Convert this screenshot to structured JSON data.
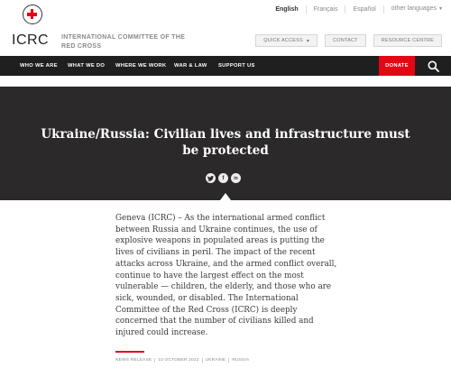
{
  "languages": [
    {
      "label": "English",
      "active": true
    },
    {
      "label": "Français",
      "active": false
    },
    {
      "label": "Español",
      "active": false
    },
    {
      "label": "other languages",
      "active": false
    }
  ],
  "logo": {
    "text": "ICRC"
  },
  "org_name": "INTERNATIONAL COMMITTEE OF THE RED CROSS",
  "utility": {
    "quick_access": "QUICK ACCESS",
    "contact": "CONTACT",
    "resource_centre": "RESOURCE CENTRE"
  },
  "nav": {
    "items": [
      "WHO WE ARE",
      "WHAT WE DO",
      "WHERE WE WORK",
      "WAR & LAW",
      "SUPPORT US"
    ],
    "donate": "DONATE"
  },
  "hero": {
    "title": "Ukraine/Russia: Civilian lives and infrastructure must be protected"
  },
  "share": [
    "twitter-icon",
    "facebook-icon",
    "linkedin-icon"
  ],
  "article": {
    "body": "Geneva (ICRC) – As the international armed conflict between Russia and Ukraine continues, the use of explosive weapons in populated areas is putting the lives of civilians in peril. The impact of the recent attacks across Ukraine, and the armed conflict overall, continue to have the largest effect on the most vulnerable — children, the elderly, and those who are sick, wounded, or disabled. The International Committee of the Red Cross (ICRC) is deeply concerned that the number of civilians killed and injured could increase."
  },
  "meta": {
    "type": "NEWS RELEASE",
    "date": "10 OCTOBER 2022",
    "tags": [
      "UKRAINE",
      "RUSSIA"
    ]
  },
  "colors": {
    "brand_red": "#e30613",
    "nav_bg": "#1f1f1f",
    "hero_bg": "#2b2929"
  }
}
